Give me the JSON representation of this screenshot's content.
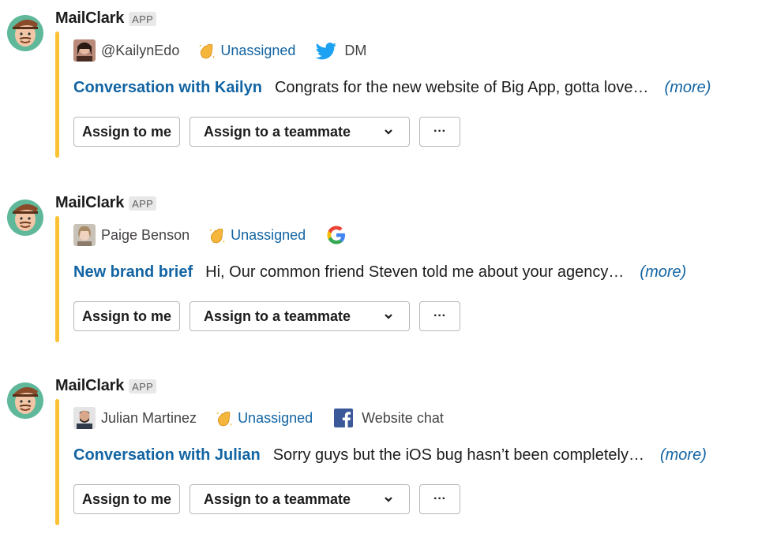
{
  "messages": [
    {
      "sender": "MailClark",
      "badge": "APP",
      "person": "@KailynEdo",
      "status": "Unassigned",
      "channel_icon": "twitter-icon",
      "channel": "DM",
      "title": "Conversation with Kailyn",
      "snippet": "Congrats for the new website of Big App, gotta love…",
      "more": "(more)",
      "assign_me": "Assign to me",
      "assign_teammate": "Assign to a teammate",
      "overflow": "···"
    },
    {
      "sender": "MailClark",
      "badge": "APP",
      "person": "Paige Benson",
      "status": "Unassigned",
      "channel_icon": "google-icon",
      "channel": "",
      "title": "New brand brief",
      "snippet": "Hi, Our common friend Steven told me about your agency…",
      "more": "(more)",
      "assign_me": "Assign to me",
      "assign_teammate": "Assign to a teammate",
      "overflow": "···"
    },
    {
      "sender": "MailClark",
      "badge": "APP",
      "person": "Julian Martinez",
      "status": "Unassigned",
      "channel_icon": "facebook-icon",
      "channel": "Website chat",
      "title": "Conversation with Julian",
      "snippet": "Sorry guys but the iOS bug hasn’t been completely…",
      "more": "(more)",
      "assign_me": "Assign to me",
      "assign_teammate": "Assign to a teammate",
      "overflow": "···"
    }
  ],
  "colors": {
    "accent_bar": "#fcc233",
    "link": "#1264a3",
    "text": "#1d1c1d"
  }
}
